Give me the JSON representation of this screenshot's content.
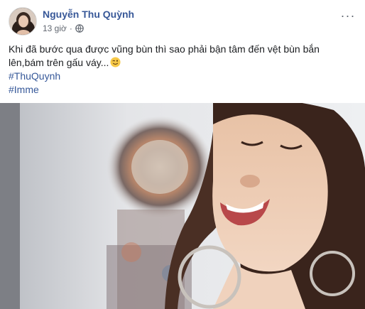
{
  "post": {
    "author": "Nguyễn Thu Quỳnh",
    "time": "13 giờ",
    "separator": "·",
    "privacy_icon": "globe-icon",
    "more_icon": "more-horizontal-icon",
    "more_label": "···",
    "text": "Khi đã bước qua được vũng bùn thì sao phải bận tâm đến vệt bùn bắn lên,bám trên gấu váy...",
    "emoji": "wink-face-emoji",
    "hashtags": [
      "#ThuQuynh",
      "#Imme"
    ]
  },
  "colors": {
    "author_link": "#385898",
    "hashtag_link": "#365899",
    "meta_text": "#616770",
    "body_text": "#1c1e21"
  }
}
